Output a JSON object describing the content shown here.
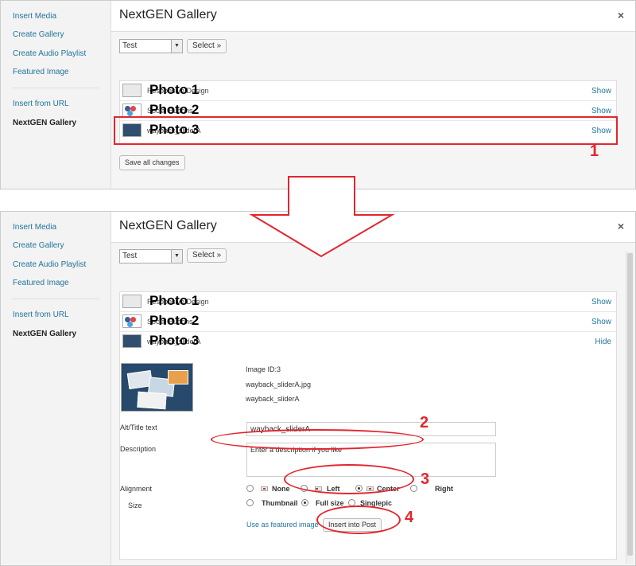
{
  "sidebar": {
    "items": [
      {
        "label": "Insert Media"
      },
      {
        "label": "Create Gallery"
      },
      {
        "label": "Create Audio Playlist"
      },
      {
        "label": "Featured Image"
      },
      {
        "label": "Insert from URL"
      },
      {
        "label": "NextGEN Gallery"
      }
    ]
  },
  "header": {
    "title": "NextGEN Gallery",
    "close": "×"
  },
  "gallery_select": {
    "value": "Test",
    "button": "Select »"
  },
  "photos": [
    {
      "overlay": "Photo 1",
      "name": "Responsive Design",
      "link": "Show"
    },
    {
      "overlay": "Photo 2",
      "name": "Social Buttons",
      "link": "Show"
    },
    {
      "overlay": "Photo 3",
      "name": "wayback_sliderA",
      "link": "Show"
    }
  ],
  "expanded_link": "Hide",
  "save_label": "Save all changes",
  "detail": {
    "image_id": "Image ID:3",
    "filename": "wayback_sliderA.jpg",
    "name": "wayback_sliderA",
    "alt_label": "Alt/Title text",
    "alt_value": "wayback_sliderA",
    "description_label": "Description",
    "description_placeholder": "Enter a description if you like",
    "alignment_label": "Alignment",
    "alignment_options": [
      "None",
      "Left",
      "Center",
      "Right"
    ],
    "alignment_selected": "Center",
    "size_label": "Size",
    "size_options": [
      "Thumbnail",
      "Full size",
      "Singlepic"
    ],
    "size_selected": "Full size",
    "featured_link": "Use as featured image",
    "insert_button": "Insert into Post"
  },
  "annotations": {
    "n1": "1",
    "n2": "2",
    "n3": "3",
    "n4": "4"
  },
  "colors": {
    "annotation": "#e2262e",
    "link": "#21759b"
  }
}
